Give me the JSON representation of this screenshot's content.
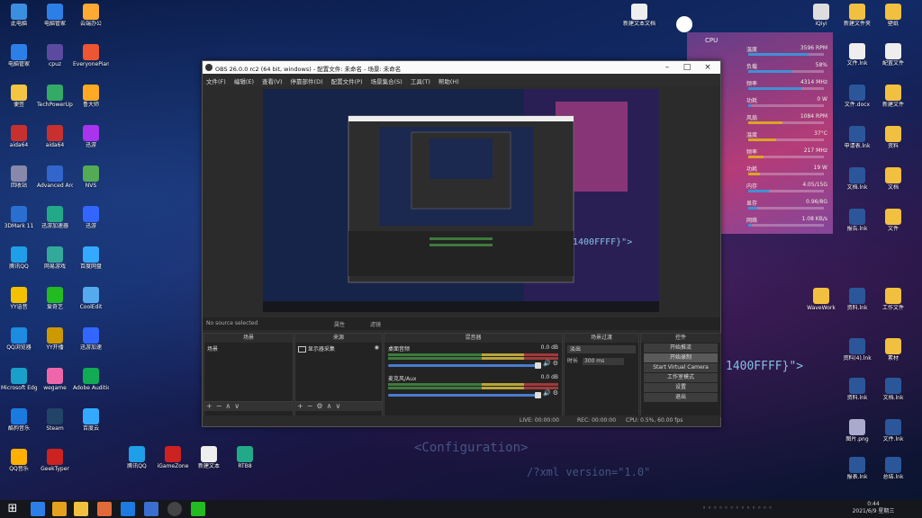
{
  "desktop_icons_left": [
    {
      "label": "此电脑",
      "color": "#3b8fe0"
    },
    {
      "label": "电脑管家",
      "color": "#2d7fe8"
    },
    {
      "label": "便签",
      "color": "#f4c542"
    },
    {
      "label": "aida64",
      "color": "#c83030"
    },
    {
      "label": "回收站",
      "color": "#88a"
    },
    {
      "label": "3DMark 11",
      "color": "#2a6fd0"
    },
    {
      "label": "腾讯QQ",
      "color": "#1f9fe8"
    },
    {
      "label": "YY语音",
      "color": "#f3c100"
    },
    {
      "label": "QQ浏览器",
      "color": "#1c8be0"
    },
    {
      "label": "Microsoft Edge",
      "color": "#1aa0c8"
    },
    {
      "label": "酷狗音乐",
      "color": "#1b7ae0"
    },
    {
      "label": "QQ音乐",
      "color": "#ffb000"
    }
  ],
  "desktop_icons_col2": [
    {
      "label": "电脑管家",
      "color": "#2d7fe8"
    },
    {
      "label": "cpuz",
      "color": "#5b4aa0"
    },
    {
      "label": "TechPowerUp GPU-Z",
      "color": "#3a6"
    },
    {
      "label": "aida64",
      "color": "#c83030"
    },
    {
      "label": "Advanced Archive",
      "color": "#36c"
    },
    {
      "label": "迅游加速器",
      "color": "#2a8"
    },
    {
      "label": "网易游戏",
      "color": "#3a9"
    },
    {
      "label": "爱奇艺",
      "color": "#2b2"
    },
    {
      "label": "YY开播",
      "color": "#c90"
    },
    {
      "label": "wegame",
      "color": "#e6a"
    },
    {
      "label": "Steam",
      "color": "#246"
    },
    {
      "label": "GeekTyper",
      "color": "#c22"
    }
  ],
  "desktop_icons_col3": [
    {
      "label": "云端办公",
      "color": "#fa3"
    },
    {
      "label": "EveryonePiano",
      "color": "#e53"
    },
    {
      "label": "鲁大师",
      "color": "#fa2"
    },
    {
      "label": "迅游",
      "color": "#a3e"
    },
    {
      "label": "NVS",
      "color": "#5a5"
    },
    {
      "label": "迅游",
      "color": "#36f"
    },
    {
      "label": "百度网盘",
      "color": "#3af"
    },
    {
      "label": "CoolEdit",
      "color": "#5ae"
    },
    {
      "label": "迅游加速",
      "color": "#36f"
    },
    {
      "label": "Adobe Audition",
      "color": "#1a5"
    },
    {
      "label": "百度云",
      "color": "#3af"
    }
  ],
  "monitor": {
    "title": "CPU",
    "rows": [
      {
        "label": "温度",
        "value": "3596 RPM",
        "pct": 0.8,
        "color": "#49d"
      },
      {
        "label": "负载",
        "value": "58%",
        "pct": 0.58,
        "color": "#49d"
      },
      {
        "label": "频率",
        "value": "4314 MHz",
        "pct": 0.7,
        "color": "#49d"
      },
      {
        "label": "功耗",
        "value": "0 W",
        "pct": 0.05,
        "color": "#49d"
      },
      {
        "label": "风扇",
        "value": "1084 RPM",
        "pct": 0.45,
        "color": "#e9b020"
      },
      {
        "label": "温度",
        "value": "37°C",
        "pct": 0.37,
        "color": "#e9b020"
      },
      {
        "label": "频率",
        "value": "217 MHz",
        "pct": 0.2,
        "color": "#e9b020"
      },
      {
        "label": "功耗",
        "value": "19 W",
        "pct": 0.15,
        "color": "#e9b020"
      },
      {
        "label": "内存",
        "value": "4.05/15G",
        "pct": 0.27,
        "color": "#49d"
      },
      {
        "label": "显存",
        "value": "0.96/8G",
        "pct": 0.12,
        "color": "#49d"
      },
      {
        "label": "网络",
        "value": "1.08 KB/s",
        "pct": 0.05,
        "color": "#49d"
      }
    ]
  },
  "obs": {
    "title": "OBS 26.0.0 rc2 (64 bit, windows) - 配置文件: 未命名 - 场景: 未命名",
    "menu": [
      "文件(F)",
      "编辑(E)",
      "查看(V)",
      "停靠部件(D)",
      "配置文件(P)",
      "场景集合(S)",
      "工具(T)",
      "帮助(H)"
    ],
    "source_bar": {
      "none": "No source selected",
      "props": "属性",
      "filters": "滤镜"
    },
    "docks": {
      "scenes": "场景",
      "sources": "来源",
      "mixer": "混音器",
      "transitions": "场景过渡",
      "controls": "控件"
    },
    "scene_item": "场景",
    "source_item": "显示器采集",
    "mixer": [
      {
        "name": "桌面音频",
        "db": "0.0 dB"
      },
      {
        "name": "麦克风/Aux",
        "db": "0.0 dB"
      }
    ],
    "transition": {
      "name": "淡出",
      "duration_label": "时长",
      "duration": "300 ms"
    },
    "controls": [
      "开始推流",
      "开始录制",
      "Start Virtual Camera",
      "工作室模式",
      "设置",
      "退出"
    ],
    "status": {
      "live": "LIVE: 00:00:00",
      "rec": "REC: 00:00:00",
      "cpu": "CPU: 0.5%, 60.00 fps"
    }
  },
  "desktop_text": {
    "hex": "1400FFFF}\">",
    "mid_hex": "1400FFFF}\">"
  },
  "taskbar": {
    "time": "0:44",
    "date": "2021/6/9 星期三"
  }
}
